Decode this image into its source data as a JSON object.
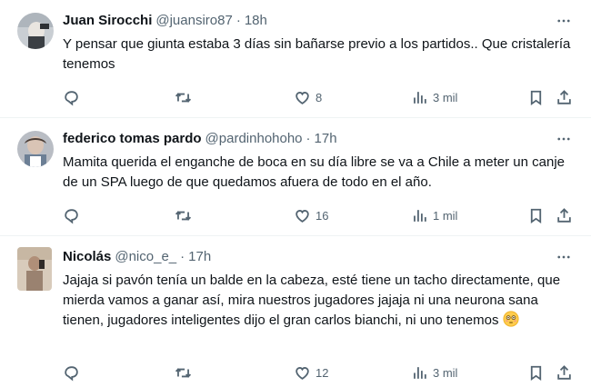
{
  "tweets": [
    {
      "name": "Juan Sirocchi",
      "handle": "@juansiro87",
      "sep": "·",
      "time": "18h",
      "text": "Y pensar que giunta estaba 3 días sin bañarse previo a los partidos.. Que cristalería tenemos",
      "replies": "",
      "retweets": "",
      "likes": "8",
      "views": "3 mil"
    },
    {
      "name": "federico tomas pardo",
      "handle": "@pardinhohoho",
      "sep": "·",
      "time": "17h",
      "text": "Mamita querida el enganche de boca en su día libre se va a Chile a meter un canje de un SPA luego de que quedamos afuera de todo en el año.",
      "replies": "",
      "retweets": "",
      "likes": "16",
      "views": "1 mil"
    },
    {
      "name": "Nicolás",
      "handle": "@nico_e_",
      "sep": "·",
      "time": "17h",
      "text": "Jajaja si pavón tenía un balde en la cabeza, esté tiene un tacho directamente, que mierda vamos a ganar así, mira nuestros jugadores jajaja ni una neurona sana tienen, jugadores inteligentes dijo el gran carlos bianchi, ni uno tenemos",
      "emoji": "flushed-face-emoji",
      "replies": "",
      "retweets": "",
      "likes": "12",
      "views": "3 mil"
    }
  ],
  "colors": {
    "text": "#0f1419",
    "secondary": "#536471",
    "divider": "#eff3f4"
  },
  "icons": [
    "reply-icon",
    "retweet-icon",
    "like-icon",
    "views-icon",
    "bookmark-icon",
    "share-icon",
    "more-icon"
  ]
}
